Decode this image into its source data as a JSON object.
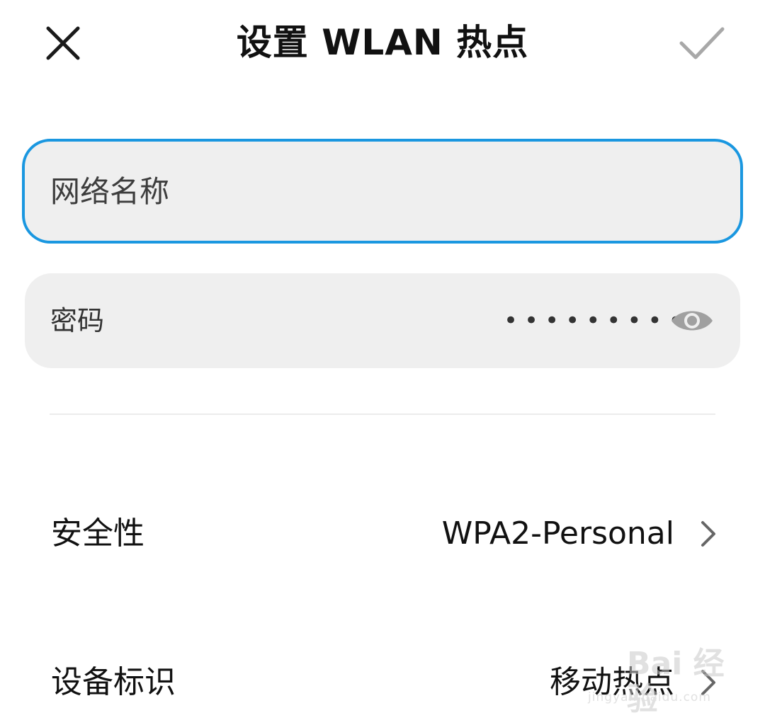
{
  "header": {
    "title": "设置 WLAN 热点",
    "close_icon": "close-icon",
    "confirm_icon": "checkmark-icon"
  },
  "form": {
    "network_name": {
      "placeholder": "网络名称",
      "value": ""
    },
    "password": {
      "label": "密码",
      "masked_value": "•••••••••",
      "visibility_icon": "eye-icon"
    }
  },
  "rows": {
    "security": {
      "label": "安全性",
      "value": "WPA2-Personal",
      "icon": "chevron-right-icon"
    },
    "device_id": {
      "label": "设备标识",
      "value": "移动热点",
      "icon": "chevron-right-icon"
    }
  },
  "watermark": {
    "text": "Bai 经验",
    "sub": "jingyan.baidu.com"
  },
  "colors": {
    "accent": "#1a97e0",
    "field_bg": "#efefef",
    "text": "#111111",
    "icon_gray": "#9e9e9e"
  }
}
